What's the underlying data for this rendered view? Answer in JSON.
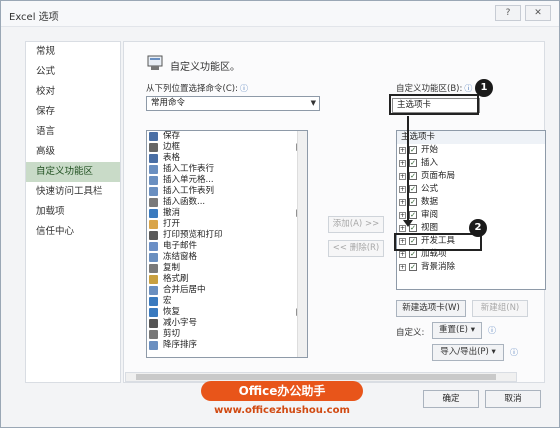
{
  "window": {
    "title": "Excel 选项",
    "help_glyph": "?",
    "close_glyph": "✕"
  },
  "sidebar": {
    "items": [
      {
        "label": "常规"
      },
      {
        "label": "公式"
      },
      {
        "label": "校对"
      },
      {
        "label": "保存"
      },
      {
        "label": "语言"
      },
      {
        "label": "高级"
      },
      {
        "label": "自定义功能区",
        "active": true
      },
      {
        "label": "快速访问工具栏"
      },
      {
        "label": "加载项"
      },
      {
        "label": "信任中心"
      }
    ]
  },
  "header": {
    "title": "自定义功能区。"
  },
  "left": {
    "label": "从下列位置选择命令(C):",
    "info": "ⓘ",
    "dropdown_value": "常用命令",
    "commands": [
      {
        "label": "保存",
        "icon_color": "#4a6fa5",
        "more": ""
      },
      {
        "label": "边框",
        "icon_color": "#666666",
        "more": "|▸"
      },
      {
        "label": "表格",
        "icon_color": "#4a6fa5",
        "more": ""
      },
      {
        "label": "插入工作表行",
        "icon_color": "#6a8fc0",
        "more": ""
      },
      {
        "label": "插入单元格...",
        "icon_color": "#6a8fc0",
        "more": ""
      },
      {
        "label": "插入工作表列",
        "icon_color": "#6a8fc0",
        "more": ""
      },
      {
        "label": "插入函数...",
        "icon_color": "#7a7a7a",
        "more": ""
      },
      {
        "label": "撤消",
        "icon_color": "#3a7abf",
        "more": "|▸"
      },
      {
        "label": "打开",
        "icon_color": "#d9a54a",
        "more": ""
      },
      {
        "label": "打印预览和打印",
        "icon_color": "#5a5a5a",
        "more": ""
      },
      {
        "label": "电子邮件",
        "icon_color": "#6b8fc6",
        "more": ""
      },
      {
        "label": "冻结窗格",
        "icon_color": "#6a8fc0",
        "more": "▸"
      },
      {
        "label": "复制",
        "icon_color": "#7a7a7a",
        "more": ""
      },
      {
        "label": "格式刷",
        "icon_color": "#c9a040",
        "more": ""
      },
      {
        "label": "合并后居中",
        "icon_color": "#6a8fc0",
        "more": ""
      },
      {
        "label": "宏",
        "icon_color": "#3a7abf",
        "more": "▸"
      },
      {
        "label": "恢复",
        "icon_color": "#3a7abf",
        "more": "|▸"
      },
      {
        "label": "减小字号",
        "icon_color": "#555555",
        "more": ""
      },
      {
        "label": "剪切",
        "icon_color": "#777777",
        "more": ""
      },
      {
        "label": "降序排序",
        "icon_color": "#6a8fc0",
        "more": ""
      }
    ]
  },
  "middle": {
    "add_label": "添加(A) >>",
    "remove_label": "<< 删除(R)"
  },
  "right": {
    "label": "自定义功能区(B):",
    "info": "ⓘ",
    "dropdown_value": "主选项卡",
    "tree_header": "主选项卡",
    "tabs": [
      {
        "label": "开始",
        "expander": "+",
        "check": "✓"
      },
      {
        "label": "插入",
        "expander": "+",
        "check": "✓"
      },
      {
        "label": "页面布局",
        "expander": "+",
        "check": "✓"
      },
      {
        "label": "公式",
        "expander": "+",
        "check": "✓"
      },
      {
        "label": "数据",
        "expander": "+",
        "check": "✓"
      },
      {
        "label": "审阅",
        "expander": "+",
        "check": "✓"
      },
      {
        "label": "视图",
        "expander": "+",
        "check": "✓"
      },
      {
        "label": "开发工具",
        "expander": "+",
        "check": "✓"
      },
      {
        "label": "加载项",
        "expander": "+",
        "check": "✓"
      },
      {
        "label": "背景消除",
        "expander": "+",
        "check": "✓"
      }
    ],
    "new_tab_label": "新建选项卡(W)",
    "new_group_label": "新建组(N)",
    "custom_label": "自定义:",
    "reset_label": "重置(E) ▾",
    "import_export_label": "导入/导出(P) ▾"
  },
  "annotations": {
    "badge_1": "1",
    "badge_2": "2"
  },
  "footer": {
    "ok_label": "确定",
    "cancel_label": "取消"
  },
  "watermark": {
    "brand": "Office办公助手",
    "url": "www.officezhushou.com"
  }
}
